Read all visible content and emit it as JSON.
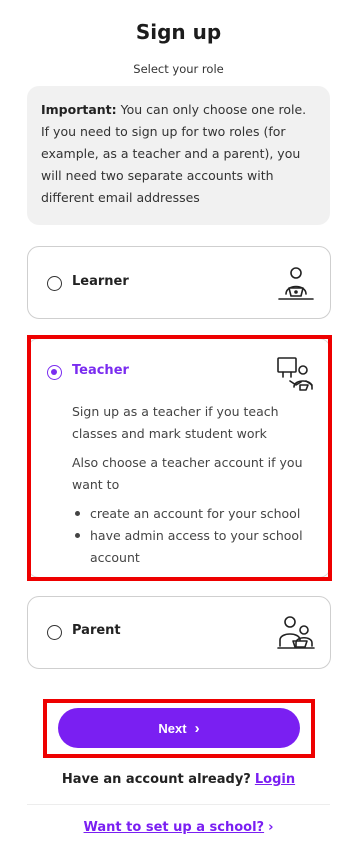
{
  "header": {
    "title": "Sign up",
    "subtitle": "Select your role"
  },
  "notice": {
    "bold": "Important:",
    "text": " You can only choose one role. If you need to sign up for two roles (for example, as a teacher and a parent), you will need two separate accounts with different email addresses"
  },
  "roles": {
    "learner": {
      "label": "Learner",
      "selected": false,
      "icon": "learner-laptop-icon"
    },
    "teacher": {
      "label": "Teacher",
      "selected": true,
      "icon": "teacher-board-icon",
      "desc1": "Sign up as a teacher if you teach classes and mark student work",
      "desc2": "Also choose a teacher account if you want to",
      "bullets": [
        "create an account for your school",
        "have admin access to your school account"
      ]
    },
    "parent": {
      "label": "Parent",
      "selected": false,
      "icon": "parent-child-icon"
    }
  },
  "actions": {
    "next_label": "Next",
    "have_account": "Have an account already?",
    "login_label": "Login",
    "school_link": "Want to set up a school?"
  },
  "colors": {
    "accent": "#7a1ff2",
    "highlight": "#ee0000",
    "notice_bg": "#f1f1f1"
  }
}
